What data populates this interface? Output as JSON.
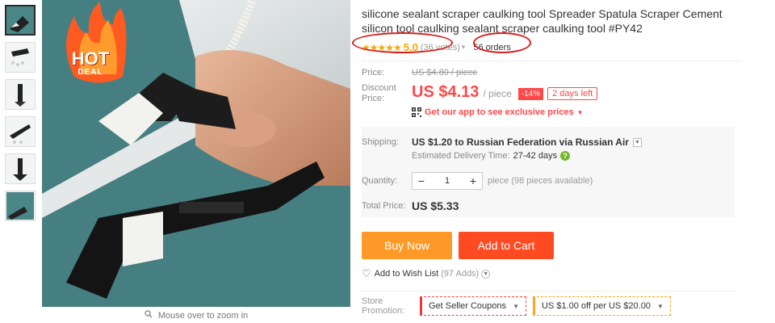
{
  "thumbnails": [
    {
      "name": "thumb-1",
      "active": true
    },
    {
      "name": "thumb-2",
      "active": false
    },
    {
      "name": "thumb-3",
      "active": false
    },
    {
      "name": "thumb-4",
      "active": false
    },
    {
      "name": "thumb-5",
      "active": false
    },
    {
      "name": "thumb-6",
      "active": false
    }
  ],
  "main_image": {
    "badge_line1": "HOT",
    "badge_line2": "DEAL",
    "zoom_hint": "Mouse over to zoom in"
  },
  "product": {
    "title": "silicone sealant scraper caulking tool Spreader Spatula Scraper Cement silicon tool caulking sealant scraper caulking tool #PY42",
    "stars": "★★★★★",
    "rating": "5.0",
    "votes": "(36 votes)",
    "orders": "56 orders"
  },
  "price": {
    "price_label": "Price:",
    "original": "US $4.80 / piece",
    "discount_label": "Discount Price:",
    "discount": "US $4.13",
    "per_unit": "/ piece",
    "percent_off": "-14%",
    "days_left": "2 days left",
    "app_promo": "Get our app to see exclusive prices"
  },
  "shipping": {
    "label": "Shipping:",
    "value": "US $1.20 to Russian Federation via Russian Air",
    "est_label": "Estimated Delivery Time:",
    "est_days": "27-42 days",
    "qty_label": "Quantity:",
    "qty_value": "1",
    "qty_minus": "−",
    "qty_plus": "+",
    "qty_note": "piece (98 pieces available)",
    "total_label": "Total Price:",
    "total_value": "US $5.33"
  },
  "actions": {
    "buy_now": "Buy Now",
    "add_to_cart": "Add to Cart",
    "wish": "Add to Wish List",
    "wish_adds": "(97 Adds)"
  },
  "promotion": {
    "label": "Store Promotion:",
    "seller_coupons": "Get Seller Coupons",
    "coupon_text": "US $1.00 off per US $20.00"
  },
  "colors": {
    "accent_red": "#ff4747",
    "buy_now": "#ff9a28",
    "add_cart": "#ff4a22",
    "star": "#f7a800",
    "annotation": "#d8201e"
  }
}
